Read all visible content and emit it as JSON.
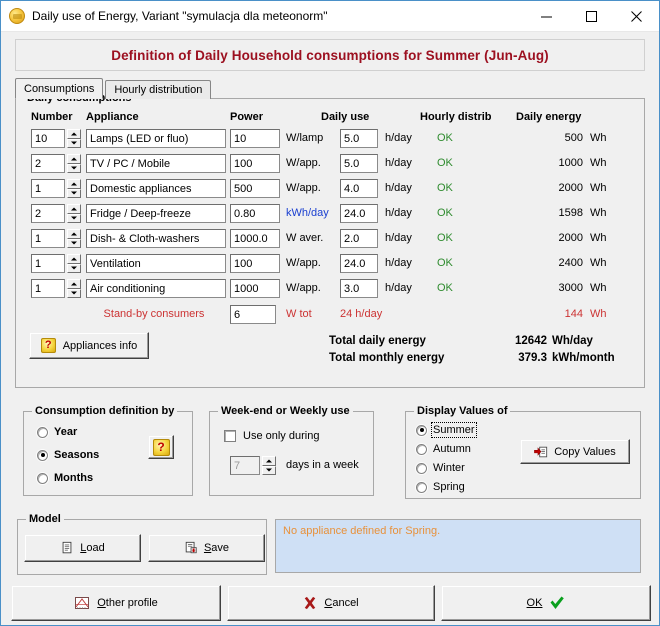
{
  "window": {
    "title": "Daily use of Energy, Variant  \"symulacja dla meteonorm\"",
    "icon": "sun-icon",
    "minimize": "minimize-icon",
    "maximize": "maximize-icon",
    "close": "close-icon"
  },
  "banner": {
    "text": "Definition of Daily Household consumptions for Summer (Jun-Aug)",
    "color": "#9c1020"
  },
  "tabs": [
    {
      "label": "Consumptions",
      "active": true
    },
    {
      "label": "Hourly distribution",
      "active": false
    }
  ],
  "main_group": {
    "legend": "Daily consumptions",
    "columns": [
      "Number",
      "Appliance",
      "Power",
      "Daily use",
      "Hourly distrib",
      "Daily energy"
    ],
    "rows": [
      {
        "number": "10",
        "appliance": "Lamps (LED or fluo)",
        "power": "10",
        "power_unit": "W/lamp",
        "power_unit_color": "#000000",
        "daily_use": "5.0",
        "use_unit": "h/day",
        "distrib": "OK",
        "energy": "500",
        "energy_unit": "Wh"
      },
      {
        "number": "2",
        "appliance": "TV / PC / Mobile",
        "power": "100",
        "power_unit": "W/app.",
        "power_unit_color": "#000000",
        "daily_use": "5.0",
        "use_unit": "h/day",
        "distrib": "OK",
        "energy": "1000",
        "energy_unit": "Wh"
      },
      {
        "number": "1",
        "appliance": "Domestic appliances",
        "power": "500",
        "power_unit": "W/app.",
        "power_unit_color": "#000000",
        "daily_use": "4.0",
        "use_unit": "h/day",
        "distrib": "OK",
        "energy": "2000",
        "energy_unit": "Wh"
      },
      {
        "number": "2",
        "appliance": "Fridge / Deep-freeze",
        "power": "0.80",
        "power_unit": "kWh/day",
        "power_unit_color": "#1a3fd0",
        "daily_use": "24.0",
        "use_unit": "h/day",
        "distrib": "OK",
        "energy": "1598",
        "energy_unit": "Wh"
      },
      {
        "number": "1",
        "appliance": "Dish- & Cloth-washers",
        "power": "1000.0",
        "power_unit": "W aver.",
        "power_unit_color": "#000000",
        "daily_use": "2.0",
        "use_unit": "h/day",
        "distrib": "OK",
        "energy": "2000",
        "energy_unit": "Wh"
      },
      {
        "number": "1",
        "appliance": "Ventilation",
        "power": "100",
        "power_unit": "W/app.",
        "power_unit_color": "#000000",
        "daily_use": "24.0",
        "use_unit": "h/day",
        "distrib": "OK",
        "energy": "2400",
        "energy_unit": "Wh"
      },
      {
        "number": "1",
        "appliance": "Air conditioning",
        "power": "1000",
        "power_unit": "W/app.",
        "power_unit_color": "#000000",
        "daily_use": "3.0",
        "use_unit": "h/day",
        "distrib": "OK",
        "energy": "3000",
        "energy_unit": "Wh"
      }
    ],
    "standby": {
      "label": "Stand-by consumers",
      "value": "6",
      "unit": "W tot",
      "daily_use": "24 h/day",
      "energy": "144",
      "energy_unit": "Wh",
      "color": "#cc3333"
    },
    "appliances_info_button": "Appliances info",
    "totals": [
      {
        "label": "Total daily energy",
        "value": "12642",
        "unit": "Wh/day"
      },
      {
        "label": "Total monthly energy",
        "value": "379.3",
        "unit": "kWh/month"
      }
    ]
  },
  "consumption_definition": {
    "legend": "Consumption definition by",
    "options": [
      {
        "label": "Year",
        "selected": false
      },
      {
        "label": "Seasons",
        "selected": true
      },
      {
        "label": "Months",
        "selected": false
      }
    ],
    "help_button": "?"
  },
  "weekend": {
    "legend": "Week-end or Weekly use",
    "checkbox_label": "Use only during",
    "checked": false,
    "days_value": "7",
    "days_label": "days in a week"
  },
  "display_values": {
    "legend": "Display Values of",
    "options": [
      {
        "label": "Summer",
        "selected": true
      },
      {
        "label": "Autumn",
        "selected": false
      },
      {
        "label": "Winter",
        "selected": false
      },
      {
        "label": "Spring",
        "selected": false
      }
    ],
    "copy_button": "Copy Values"
  },
  "model": {
    "legend": "Model",
    "load_button": "Load",
    "save_button": "Save"
  },
  "status": {
    "message": "No appliance defined for Spring.",
    "color": "#e8913a",
    "background": "#cfe0f5"
  },
  "footer": {
    "other_profile": "Other profile",
    "cancel": "Cancel",
    "ok": "OK"
  }
}
